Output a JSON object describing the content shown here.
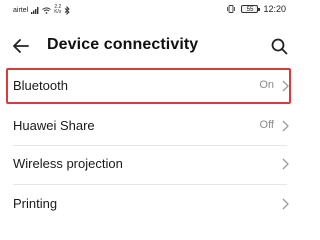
{
  "status_bar": {
    "carrier": "airtel",
    "speed_value": "2.2",
    "speed_unit": "K/s",
    "battery": "55",
    "time": "12:20",
    "icons": [
      "signal-icon",
      "wifi-icon",
      "bluetooth-icon",
      "vibrate-icon",
      "battery-icon"
    ]
  },
  "header": {
    "title": "Device connectivity",
    "back_icon": "arrow-left-icon",
    "search_icon": "search-icon"
  },
  "settings": [
    {
      "label": "Bluetooth",
      "value": "On"
    },
    {
      "label": "Huawei Share",
      "value": "Off"
    },
    {
      "label": "Wireless projection",
      "value": ""
    },
    {
      "label": "Printing",
      "value": ""
    }
  ],
  "colors": {
    "highlight": "#d93a3a",
    "secondary_text": "#8a8a8a",
    "divider": "#e6e6e6"
  }
}
